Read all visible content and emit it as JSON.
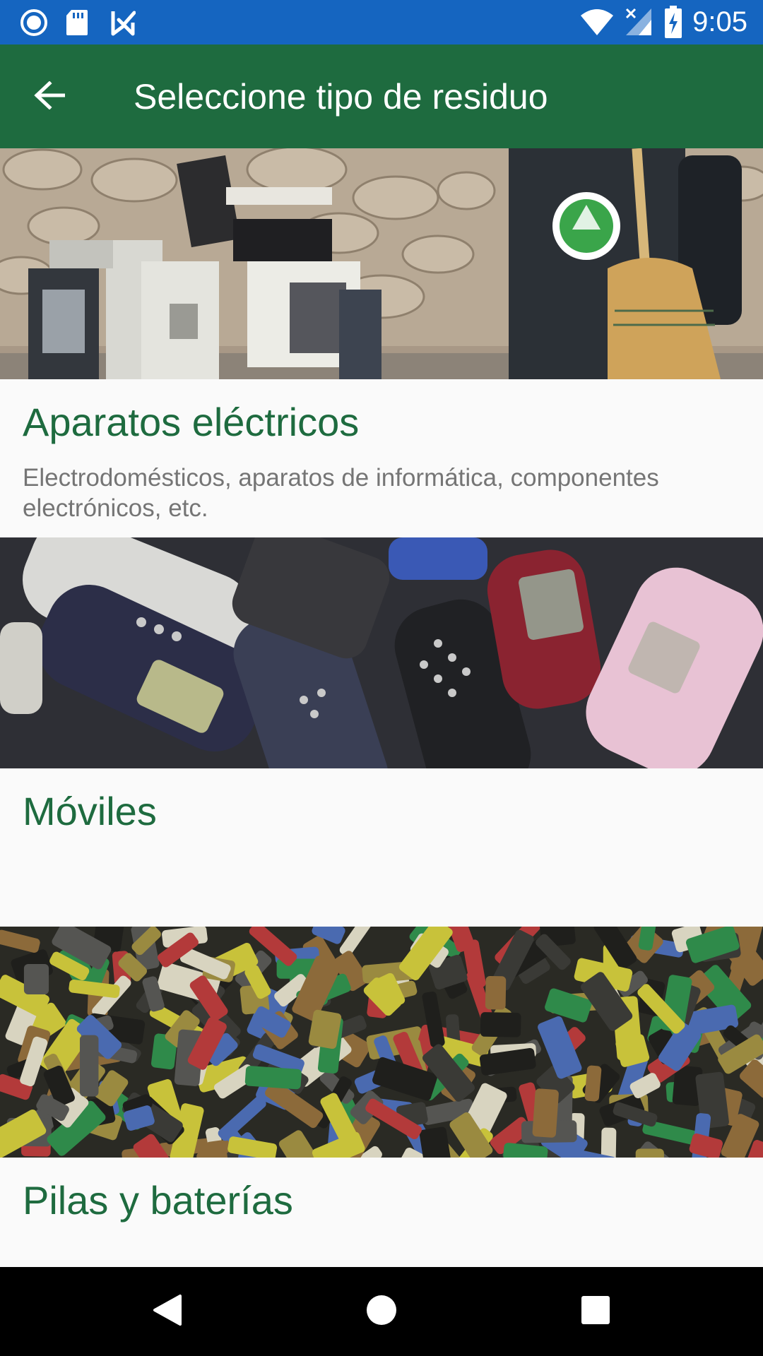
{
  "status_bar": {
    "time": "9:05",
    "left_icons": [
      "sync-circle-icon",
      "sd-card-icon",
      "checkbox-flag-icon"
    ],
    "right_icons": [
      "wifi-icon",
      "signal-icon",
      "battery-charging-icon"
    ],
    "background": "#1565c0"
  },
  "app_bar": {
    "title": "Seleccione tipo de residuo",
    "back_icon": "arrow-back-icon",
    "background": "#1e6b3f"
  },
  "waste_types": [
    {
      "title": "Aparatos eléctricos",
      "description": "Electrodomésticos, aparatos de informática, componentes electrónicos, etc.",
      "image": "electronic-waste-photo"
    },
    {
      "title": "Móviles",
      "description": "",
      "image": "mobile-phones-photo"
    },
    {
      "title": "Pilas y baterías",
      "description": "",
      "image": "batteries-photo"
    }
  ],
  "nav_bar": {
    "buttons": [
      "back-triangle-icon",
      "home-circle-icon",
      "recents-square-icon"
    ]
  },
  "colors": {
    "title_green": "#1e6b3f",
    "description_gray": "#757575",
    "list_background": "#fafafa"
  }
}
